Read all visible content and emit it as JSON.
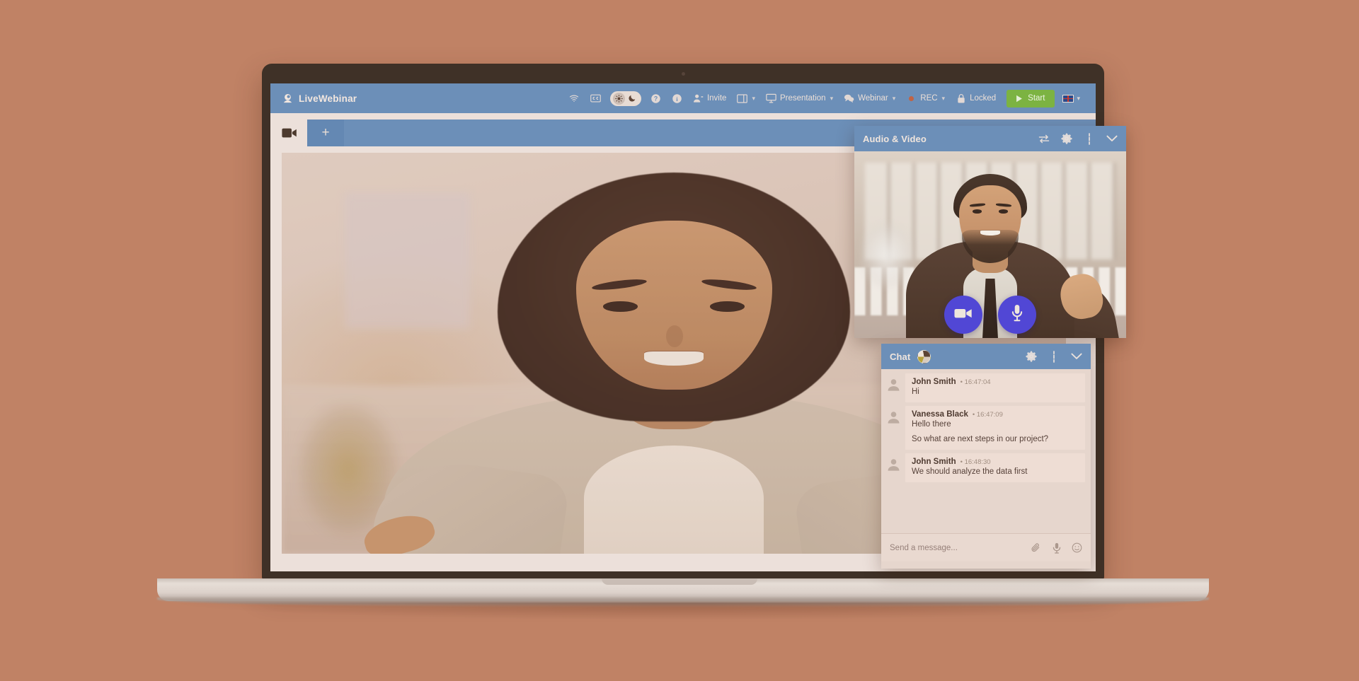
{
  "app": {
    "brand_name": "LiveWebinar",
    "brand_icon": "webinar-logo-icon"
  },
  "topbar": {
    "items": [
      {
        "icon": "wifi-icon",
        "label": ""
      },
      {
        "icon": "closed-caption-icon",
        "label": ""
      },
      {
        "icon": "theme-toggle-icon",
        "label": ""
      },
      {
        "icon": "help-icon",
        "label": ""
      },
      {
        "icon": "info-icon",
        "label": ""
      },
      {
        "icon": "invite-person-icon",
        "label": "Invite"
      },
      {
        "icon": "layout-icon",
        "label": ""
      },
      {
        "icon": "presentation-screen-icon",
        "label": "Presentation"
      },
      {
        "icon": "chat-bubbles-icon",
        "label": "Webinar"
      },
      {
        "icon": "record-dot-icon",
        "label": "REC"
      },
      {
        "icon": "lock-icon",
        "label": "Locked"
      }
    ],
    "invite_label": "Invite",
    "presentation_label": "Presentation",
    "webinar_label": "Webinar",
    "rec_label": "REC",
    "locked_label": "Locked",
    "start_label": "Start",
    "language_flag": "uk-flag-icon",
    "accent_blue": "#6c8fb8",
    "start_green": "#7cb342",
    "rec_red": "#c9603a"
  },
  "tabbar": {
    "camera_icon": "video-camera-icon",
    "add_tab_label": "+",
    "volume_icon": "speaker-volume-icon",
    "fullscreen_icon": "fullscreen-expand-icon"
  },
  "stage": {
    "presenter_alt": "main-presenter-video"
  },
  "audio_video_panel": {
    "title": "Audio & Video",
    "icons": [
      "swap-arrows-icon",
      "gear-icon",
      "more-vertical-icon",
      "chevron-down-icon"
    ],
    "controls": [
      {
        "name": "camera-toggle-button",
        "icon": "video-camera-icon"
      },
      {
        "name": "microphone-toggle-button",
        "icon": "microphone-icon"
      }
    ],
    "button_color": "#5147d5"
  },
  "chat_panel": {
    "title": "Chat",
    "avatar_icon": "chat-room-avatar",
    "icons": [
      "gear-icon",
      "more-vertical-icon",
      "chevron-down-icon"
    ],
    "messages": [
      {
        "author": "John Smith",
        "time": "16:47:04",
        "lines": [
          "Hi"
        ]
      },
      {
        "author": "Vanessa Black",
        "time": "16:47:09",
        "lines": [
          "Hello there",
          "So what are next steps in our project?"
        ]
      },
      {
        "author": "John Smith",
        "time": "16:48:30",
        "lines": [
          "We should analyze the data first"
        ]
      }
    ],
    "input_placeholder": "Send a message...",
    "input_value": "",
    "input_icons": [
      "attachment-paperclip-icon",
      "microphone-icon",
      "emoji-smiley-icon"
    ]
  },
  "theme": {
    "background": "#c08265",
    "screen_bg": "#ece0da",
    "bezel": "#3f3127"
  }
}
